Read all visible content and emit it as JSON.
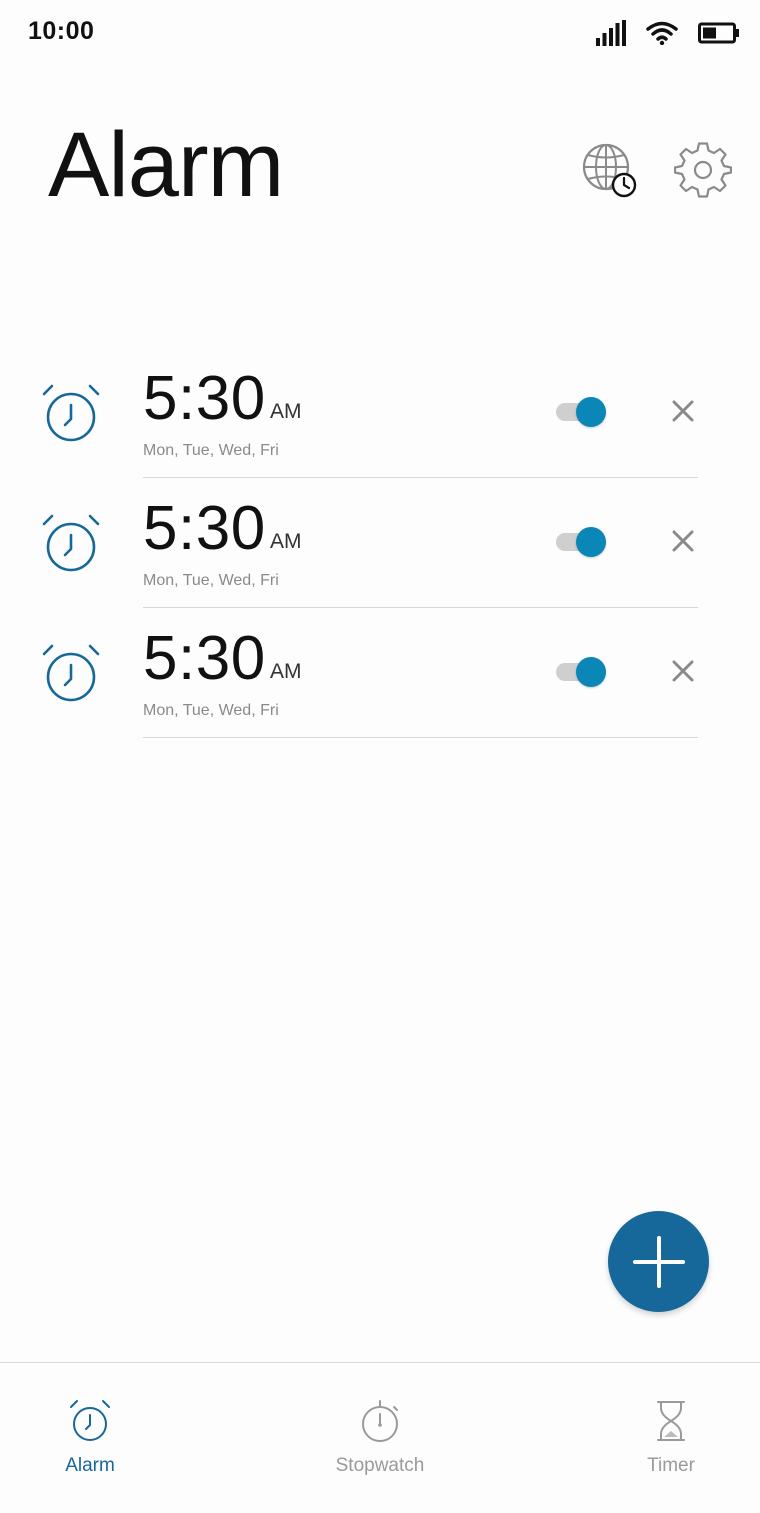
{
  "status_bar": {
    "time": "10:00",
    "icons": [
      "signal-icon",
      "wifi-icon",
      "battery-icon"
    ]
  },
  "header": {
    "title": "Alarm",
    "actions": [
      "world-clock-icon",
      "settings-gear-icon"
    ]
  },
  "alarms": [
    {
      "time": "5:30",
      "ampm": "AM",
      "days": "Mon, Tue, Wed, Fri",
      "enabled": true
    },
    {
      "time": "5:30",
      "ampm": "AM",
      "days": "Mon, Tue, Wed, Fri",
      "enabled": true
    },
    {
      "time": "5:30",
      "ampm": "AM",
      "days": "Mon, Tue, Wed, Fri",
      "enabled": true
    }
  ],
  "fab": {
    "icon": "plus-icon"
  },
  "bottom_nav": {
    "items": [
      {
        "label": "Alarm",
        "icon": "alarm-clock-icon",
        "active": true
      },
      {
        "label": "Stopwatch",
        "icon": "stopwatch-icon",
        "active": false
      },
      {
        "label": "Timer",
        "icon": "hourglass-icon",
        "active": false
      }
    ]
  },
  "colors": {
    "accent": "#16679a",
    "toggle_on": "#0a86b7",
    "icon_gray": "#8a8a8a",
    "divider": "#d8d8d8"
  }
}
